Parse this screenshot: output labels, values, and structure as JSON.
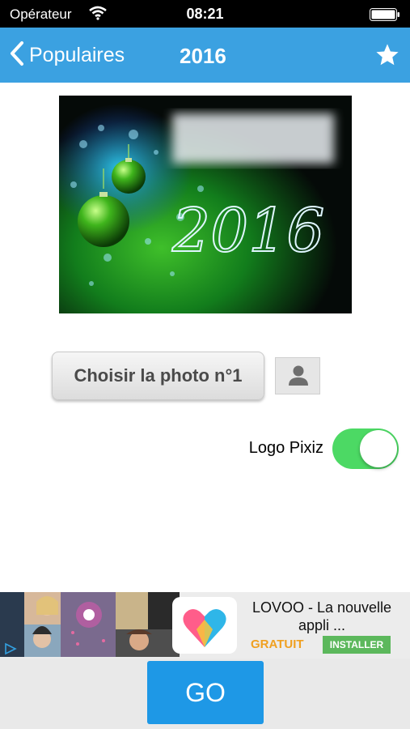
{
  "status": {
    "carrier": "Opérateur",
    "time": "08:21"
  },
  "nav": {
    "back_label": "Populaires",
    "title": "2016"
  },
  "hero": {
    "year_text": "2016"
  },
  "photo": {
    "choose_label": "Choisir la photo n°1"
  },
  "logo_toggle": {
    "label": "Logo Pixiz",
    "on": true
  },
  "ad": {
    "title": "LOVOO - La nouvelle appli ...",
    "price": "GRATUIT",
    "install_label": "INSTALLER"
  },
  "go": {
    "label": "GO"
  },
  "colors": {
    "nav": "#3ba1e1",
    "toggle_on": "#4cd964",
    "go": "#1e98e6",
    "install": "#5cb85c",
    "free": "#f0a020"
  }
}
